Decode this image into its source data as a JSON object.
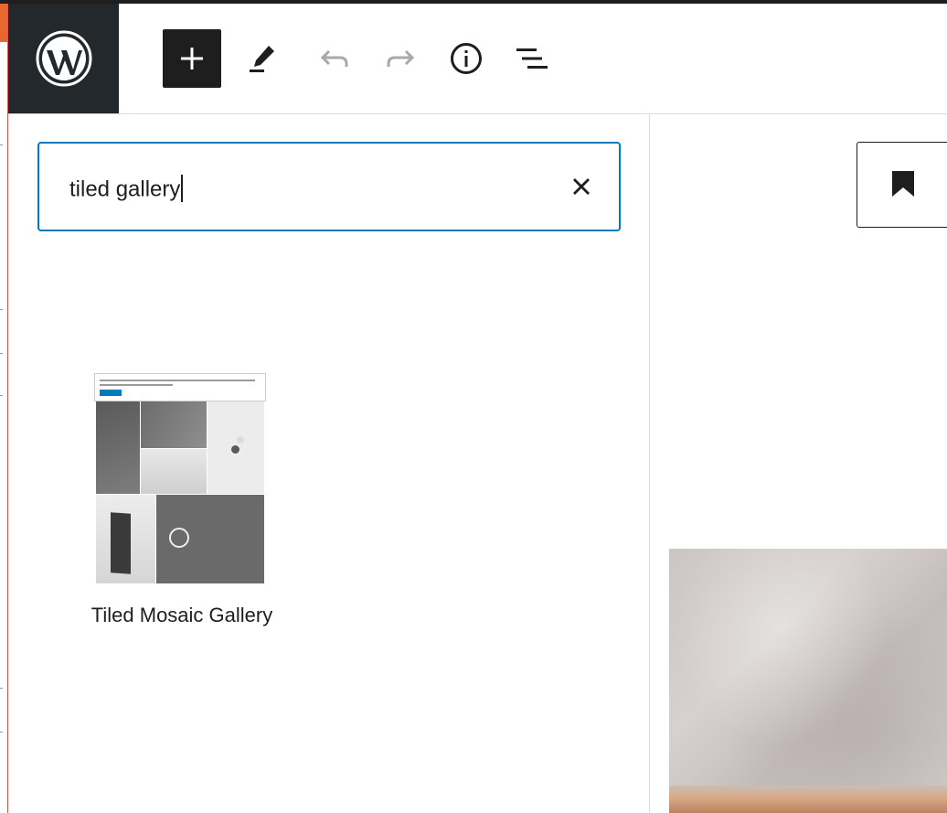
{
  "toolbar": {
    "logo_icon": "wordpress-logo-icon",
    "add_block_icon": "plus-icon",
    "tools_icon": "pencil-icon",
    "undo_icon": "undo-icon",
    "redo_icon": "redo-icon",
    "details_icon": "info-icon",
    "list_view_icon": "list-view-icon"
  },
  "inserter": {
    "search": {
      "value": "tiled gallery",
      "clear_icon": "close-icon"
    },
    "results": [
      {
        "label": "Tiled Mosaic Gallery",
        "preview": "tiled-mosaic-gallery-preview"
      }
    ]
  },
  "editor": {
    "bookmark_icon": "bookmark-icon",
    "background_image": "stone-texture-photo"
  },
  "colors": {
    "accent": "#007cba",
    "toolbar_dark": "#23282d",
    "button_dark": "#1e1e1e",
    "disabled_icon": "#a7aaad",
    "admin_accent": "#e8672d"
  }
}
